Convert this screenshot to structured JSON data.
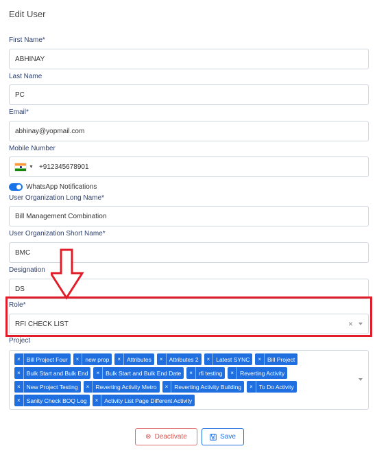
{
  "page": {
    "title": "Edit User"
  },
  "fields": {
    "first_name": {
      "label": "First Name*",
      "value": "ABHINAY"
    },
    "last_name": {
      "label": "Last Name",
      "value": "PC"
    },
    "email": {
      "label": "Email*",
      "value": "abhinay@yopmail.com"
    },
    "mobile": {
      "label": "Mobile Number",
      "country_icon": "india-flag-icon",
      "value": "+912345678901"
    },
    "whatsapp": {
      "label": "WhatsApp Notifications",
      "enabled": true
    },
    "org_long": {
      "label": "User Organization Long Name*",
      "value": "Bill Management Combination"
    },
    "org_short": {
      "label": "User Organization Short Name*",
      "value": "BMC"
    },
    "designation": {
      "label": "Designation",
      "value": "DS"
    },
    "role": {
      "label": "Role*",
      "value": "RFI CHECK LIST",
      "clear": "×"
    },
    "project": {
      "label": "Project",
      "chips": [
        "Bill Project Four",
        "new prop",
        "Attributes",
        "Attributes 2",
        "Latest SYNC",
        "Bill Project",
        "Bulk Start and Bulk End",
        "Bulk Start and Bulk End Date",
        "rfi testing",
        "Reverting Activity",
        "New Project Testing",
        "Reverting Activity Metro",
        "Reverting Activity Building",
        "To Do Activity",
        "Sanity Check BOQ Log",
        "Activity List Page Different Activity"
      ],
      "chip_remove": "×"
    }
  },
  "buttons": {
    "deactivate": "Deactivate",
    "save": "Save"
  },
  "colors": {
    "accent": "#1f6fe0",
    "highlight": "#e11d2a",
    "danger": "#d9534f"
  }
}
